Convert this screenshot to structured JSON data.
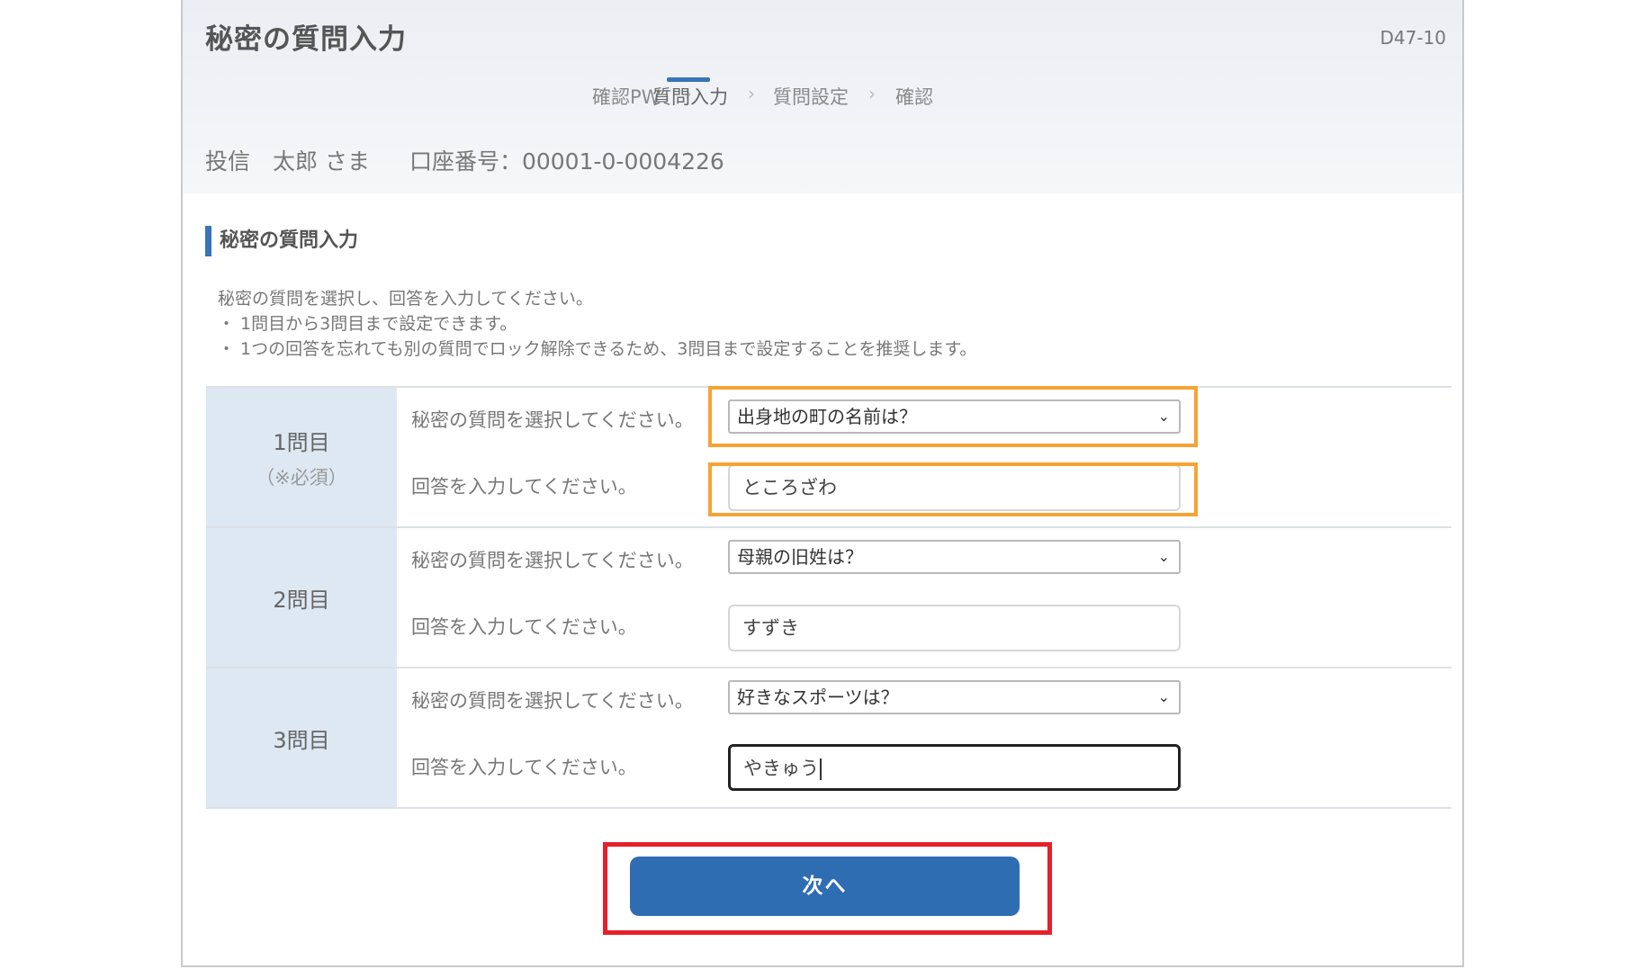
{
  "header": {
    "title": "秘密の質問入力",
    "screen_id": "D47-10",
    "steps": [
      "確認PW",
      "質問入力",
      "質問設定",
      "確認"
    ],
    "active_step": "質問入力",
    "account_name": "投信　太郎 さま",
    "account_label": "口座番号：",
    "account_number": "00001-0-0004226"
  },
  "section": {
    "title": "秘密の質問入力",
    "intro": "秘密の質問を選択し、回答を入力してください。",
    "bullets": [
      "・ 1問目から3問目まで設定できます。",
      "・ 1つの回答を忘れても別の質問でロック解除できるため、3問目まで設定することを推奨します。"
    ]
  },
  "form": {
    "question_label": "秘密の質問を選択してください。",
    "answer_label": "回答を入力してください。",
    "rows": [
      {
        "heading": "1問目",
        "required": "（※必須）",
        "selected_question": "出身地の町の名前は？",
        "answer": "ところざわ"
      },
      {
        "heading": "2問目",
        "required": "",
        "selected_question": "母親の旧姓は？",
        "answer": "すずき"
      },
      {
        "heading": "3問目",
        "required": "",
        "selected_question": "好きなスポーツは？",
        "answer": "やきゅう"
      }
    ]
  },
  "actions": {
    "next_label": "次へ"
  },
  "colors": {
    "accent": "#3a73b6",
    "button": "#2f6db3",
    "highlight_orange": "#f6a336",
    "highlight_red": "#e5202a",
    "row_head": "#dde8f2"
  },
  "icons": {
    "select_arrow": "chevron-down-icon"
  }
}
